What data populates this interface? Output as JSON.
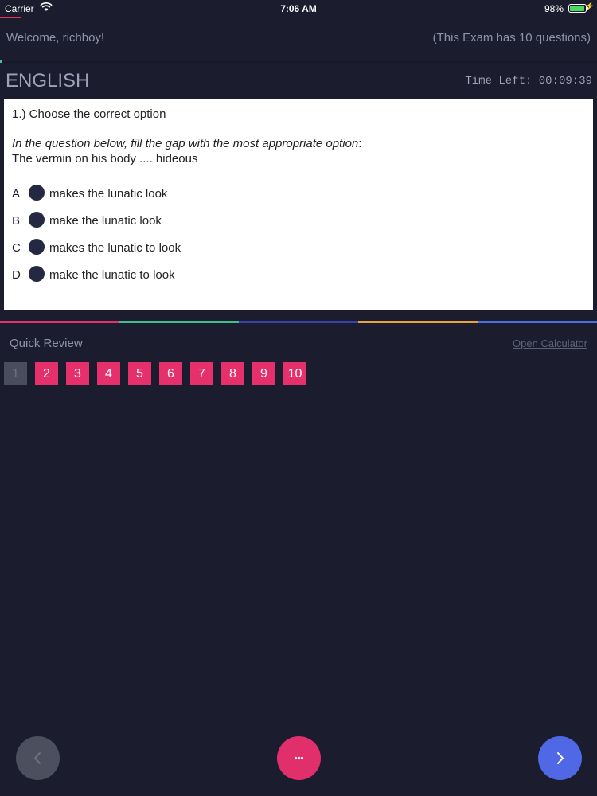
{
  "status_bar": {
    "carrier": "Carrier",
    "time": "7:06 AM",
    "battery": "98%"
  },
  "header": {
    "welcome": "Welcome, richboy!",
    "exam_info": "(This Exam has 10 questions)"
  },
  "subject": {
    "title": "ENGLISH",
    "timer": "Time Left: 00:09:39"
  },
  "question": {
    "heading": "1.) Choose the correct option",
    "instruction": "In the question below, fill the gap with the most appropriate option",
    "instruction_suffix": ":",
    "text": "The vermin on his body .... hideous",
    "options": [
      {
        "letter": "A",
        "text": "makes the lunatic look"
      },
      {
        "letter": "B",
        "text": "make the lunatic look"
      },
      {
        "letter": "C",
        "text": "makes the lunatic to look"
      },
      {
        "letter": "D",
        "text": "make the lunatic to look"
      }
    ]
  },
  "review": {
    "label": "Quick Review",
    "calculator_link": "Open Calculator",
    "current": "1",
    "questions": [
      "1",
      "2",
      "3",
      "4",
      "5",
      "6",
      "7",
      "8",
      "9",
      "10"
    ]
  },
  "colors": {
    "background": "#1b1d2e",
    "accent_pink": "#e6306b",
    "accent_blue": "#5067e6",
    "color_bar": [
      "#e6306b",
      "#3fbf8a",
      "#3b3fb0",
      "#e8a33a",
      "#4a6fe6"
    ]
  },
  "icons": {
    "prev": "chevron-left-icon",
    "menu": "more-horizontal-icon",
    "next": "chevron-right-icon",
    "wifi": "wifi-icon",
    "battery": "battery-icon"
  }
}
